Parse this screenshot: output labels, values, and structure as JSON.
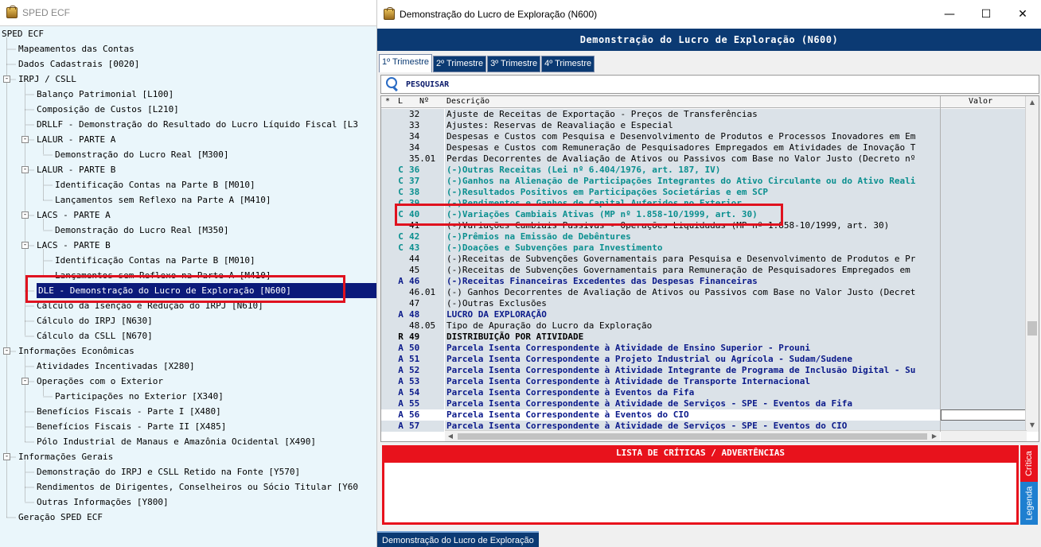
{
  "left_window": {
    "title": "SPED ECF",
    "tree": [
      {
        "label": "SPED ECF",
        "level": 0,
        "toggle": ""
      },
      {
        "label": "Mapeamentos das Contas",
        "level": 1,
        "toggle": ""
      },
      {
        "label": "Dados Cadastrais [0020]",
        "level": 1,
        "toggle": ""
      },
      {
        "label": "IRPJ / CSLL",
        "level": 1,
        "toggle": "-"
      },
      {
        "label": "Balanço Patrimonial [L100]",
        "level": 2,
        "toggle": ""
      },
      {
        "label": "Composição de Custos [L210]",
        "level": 2,
        "toggle": ""
      },
      {
        "label": "DRLLF - Demonstração do Resultado do Lucro Líquido Fiscal [L3",
        "level": 2,
        "toggle": ""
      },
      {
        "label": "LALUR - PARTE A",
        "level": 2,
        "toggle": "-"
      },
      {
        "label": "Demonstração do Lucro Real [M300]",
        "level": 3,
        "toggle": ""
      },
      {
        "label": "LALUR - PARTE B",
        "level": 2,
        "toggle": "-"
      },
      {
        "label": "Identificação Contas na Parte B [M010]",
        "level": 3,
        "toggle": ""
      },
      {
        "label": "Lançamentos sem Reflexo na Parte A [M410]",
        "level": 3,
        "toggle": ""
      },
      {
        "label": "LACS - PARTE A",
        "level": 2,
        "toggle": "-"
      },
      {
        "label": "Demonstração do Lucro Real [M350]",
        "level": 3,
        "toggle": ""
      },
      {
        "label": "LACS - PARTE B",
        "level": 2,
        "toggle": "-"
      },
      {
        "label": "Identificação Contas na Parte B [M010]",
        "level": 3,
        "toggle": ""
      },
      {
        "label": "Lançamentos sem Reflexo na Parte A [M410]",
        "level": 3,
        "toggle": ""
      },
      {
        "label": "DLE - Demonstração do Lucro de Exploração [N600]",
        "level": 2,
        "toggle": "",
        "selected": true
      },
      {
        "label": "Cálculo da Isenção e Redução do IRPJ [N610]",
        "level": 2,
        "toggle": ""
      },
      {
        "label": "Cálculo do IRPJ [N630]",
        "level": 2,
        "toggle": ""
      },
      {
        "label": "Cálculo da CSLL [N670]",
        "level": 2,
        "toggle": ""
      },
      {
        "label": "Informações Econômicas",
        "level": 1,
        "toggle": "-"
      },
      {
        "label": "Atividades Incentivadas [X280]",
        "level": 2,
        "toggle": ""
      },
      {
        "label": "Operações com o Exterior",
        "level": 2,
        "toggle": "-"
      },
      {
        "label": "Participações no Exterior [X340]",
        "level": 3,
        "toggle": ""
      },
      {
        "label": "Benefícios Fiscais - Parte I [X480]",
        "level": 2,
        "toggle": ""
      },
      {
        "label": "Benefícios Fiscais - Parte II [X485]",
        "level": 2,
        "toggle": ""
      },
      {
        "label": "Pólo Industrial de Manaus e Amazônia Ocidental [X490]",
        "level": 2,
        "toggle": ""
      },
      {
        "label": "Informações Gerais",
        "level": 1,
        "toggle": "-"
      },
      {
        "label": "Demonstração do IRPJ e CSLL Retido na Fonte [Y570]",
        "level": 2,
        "toggle": ""
      },
      {
        "label": "Rendimentos de Dirigentes, Conselheiros ou Sócio Titular [Y60",
        "level": 2,
        "toggle": ""
      },
      {
        "label": "Outras Informações [Y800]",
        "level": 2,
        "toggle": ""
      },
      {
        "label": "Geração SPED ECF",
        "level": 1,
        "toggle": ""
      }
    ]
  },
  "right_window": {
    "title": "Demonstração do Lucro de Exploração (N600)",
    "controls": {
      "minimize": "—",
      "maximize": "☐",
      "close": "✕"
    },
    "banner": "Demonstração do Lucro de Exploração (N600)",
    "tabs": [
      "1º Trimestre",
      "2º Trimestre",
      "3º Trimestre",
      "4º Trimestre"
    ],
    "search_label": "PESQUISAR",
    "columns": {
      "ast": "*",
      "l": "L",
      "n": "Nº",
      "desc": "Descrição",
      "valor": "Valor"
    },
    "rows": [
      {
        "l": "",
        "n": "32",
        "d": "Ajuste de Receitas de Exportação - Preços de Transferências",
        "s": "norm"
      },
      {
        "l": "",
        "n": "33",
        "d": "Ajustes: Reservas de Reavaliação e Especial",
        "s": "norm"
      },
      {
        "l": "",
        "n": "34",
        "d": "Despesas e Custos com Pesquisa e Desenvolvimento de Produtos e Processos Inovadores em Em",
        "s": "norm"
      },
      {
        "l": "",
        "n": "34",
        "d": "Despesas e Custos com Remuneração de Pesquisadores Empregados em Atividades de Inovação T",
        "s": "norm"
      },
      {
        "l": "",
        "n": "35.01",
        "d": "Perdas Decorrentes de Avaliação de Ativos ou Passivos com Base no Valor Justo (Decreto nº",
        "s": "norm"
      },
      {
        "l": "C",
        "n": "36",
        "d": "(-)Outras Receitas (Lei nº 6.404/1976, art. 187, IV)",
        "s": "teal"
      },
      {
        "l": "C",
        "n": "37",
        "d": "(-)Ganhos na Alienação de Participações Integrantes do Ativo Circulante ou do Ativo Reali",
        "s": "teal"
      },
      {
        "l": "C",
        "n": "38",
        "d": "(-)Resultados Positivos em Participações Societárias e em SCP",
        "s": "teal"
      },
      {
        "l": "C",
        "n": "39",
        "d": "(-)Rendimentos e Ganhos de Capital Auferidos no Exterior",
        "s": "teal"
      },
      {
        "l": "C",
        "n": "40",
        "d": "(-)Variações Cambiais Ativas (MP nº 1.858-10/1999, art. 30)",
        "s": "teal"
      },
      {
        "l": "",
        "n": "41",
        "d": "(-)Variações Cambiais Passivas - Operações Liquidadas (MP nº 1.858-10/1999, art. 30)",
        "s": "norm"
      },
      {
        "l": "C",
        "n": "42",
        "d": "(-)Prêmios na Emissão de Debêntures",
        "s": "teal"
      },
      {
        "l": "C",
        "n": "43",
        "d": "(-)Doações e Subvenções para Investimento",
        "s": "teal"
      },
      {
        "l": "",
        "n": "44",
        "d": "(-)Receitas de Subvenções Governamentais para Pesquisa e Desenvolvimento de Produtos e Pr",
        "s": "norm"
      },
      {
        "l": "",
        "n": "45",
        "d": "(-)Receitas de Subvenções Governamentais para Remuneração de Pesquisadores Empregados em",
        "s": "norm"
      },
      {
        "l": "A",
        "n": "46",
        "d": "(-)Receitas Financeiras Excedentes das Despesas Financeiras",
        "s": "navy"
      },
      {
        "l": "",
        "n": "46.01",
        "d": "(-) Ganhos Decorrentes de Avaliação de Ativos ou Passivos com Base no Valor Justo (Decret",
        "s": "norm"
      },
      {
        "l": "",
        "n": "47",
        "d": "(-)Outras Exclusões",
        "s": "norm"
      },
      {
        "l": "A",
        "n": "48",
        "d": "LUCRO DA EXPLORAÇÃO",
        "s": "navy"
      },
      {
        "l": "",
        "n": "48.05",
        "d": "Tipo de Apuração do Lucro da Exploração",
        "s": "norm"
      },
      {
        "l": "R",
        "n": "49",
        "d": "DISTRIBUIÇÃO POR ATIVIDADE",
        "s": "black"
      },
      {
        "l": "A",
        "n": "50",
        "d": "Parcela Isenta Correspondente à Atividade de Ensino Superior - Prouni",
        "s": "navy"
      },
      {
        "l": "A",
        "n": "51",
        "d": "Parcela Isenta Correspondente a Projeto Industrial ou Agrícola - Sudam/Sudene",
        "s": "navy"
      },
      {
        "l": "A",
        "n": "52",
        "d": "Parcela Isenta Correspondente à Atividade Integrante de Programa de Inclusão Digital - Su",
        "s": "navy"
      },
      {
        "l": "A",
        "n": "53",
        "d": "Parcela Isenta Correspondente à Atividade de Transporte Internacional",
        "s": "navy"
      },
      {
        "l": "A",
        "n": "54",
        "d": "Parcela Isenta Correspondente à Eventos da Fifa",
        "s": "navy"
      },
      {
        "l": "A",
        "n": "55",
        "d": "Parcela Isenta Correspondente à Atividade de Serviços - SPE - Eventos da Fifa",
        "s": "navy"
      },
      {
        "l": "A",
        "n": "56",
        "d": "Parcela Isenta Correspondente à Eventos do CIO",
        "s": "navy",
        "hl": true
      },
      {
        "l": "A",
        "n": "57",
        "d": "Parcela Isenta Correspondente à Atividade de Serviços - SPE - Eventos do CIO",
        "s": "navy"
      }
    ],
    "critics_title": "LISTA DE CRÍTICAS / ADVERTÊNCIAS",
    "side_tabs": {
      "critica": "Crítica",
      "legenda": "Legenda"
    },
    "bottom_tab": "Demonstração do Lucro de Exploração"
  },
  "colors": {
    "navy": "#0b3a73",
    "red": "#e8121c",
    "teal": "#0a8f8f",
    "selected": "#0b1a7a"
  }
}
